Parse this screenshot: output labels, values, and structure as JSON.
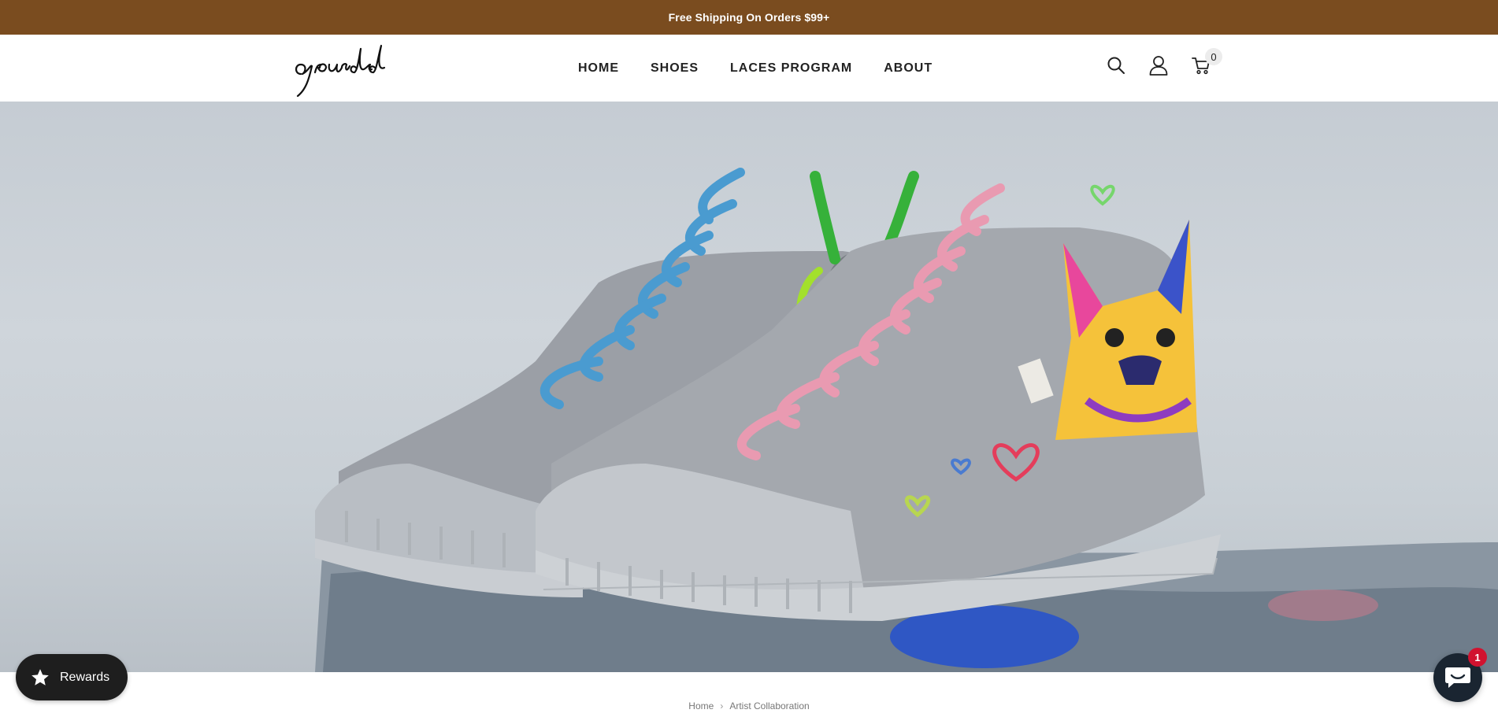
{
  "announcement": {
    "text": "Free Shipping On Orders $99+"
  },
  "header": {
    "logo_text": "grounded",
    "nav": [
      {
        "label": "HOME"
      },
      {
        "label": "SHOES"
      },
      {
        "label": "LACES PROGRAM"
      },
      {
        "label": "ABOUT"
      }
    ],
    "icons": [
      "search-icon",
      "account-icon",
      "cart-icon"
    ],
    "cart_count": "0"
  },
  "hero": {
    "image": "hand-painted-high-top-sneakers-hero"
  },
  "breadcrumb": {
    "home": "Home",
    "current": "Artist Collaboration"
  },
  "rewards": {
    "label": "Rewards",
    "icon": "star-icon"
  },
  "chat": {
    "badge": "1",
    "icon": "chat-icon"
  },
  "colors": {
    "announcement_bg": "#7a4c1f",
    "rewards_bg": "#1e1e1e",
    "chat_bg": "#1a2531",
    "chat_badge": "#d1122f"
  }
}
